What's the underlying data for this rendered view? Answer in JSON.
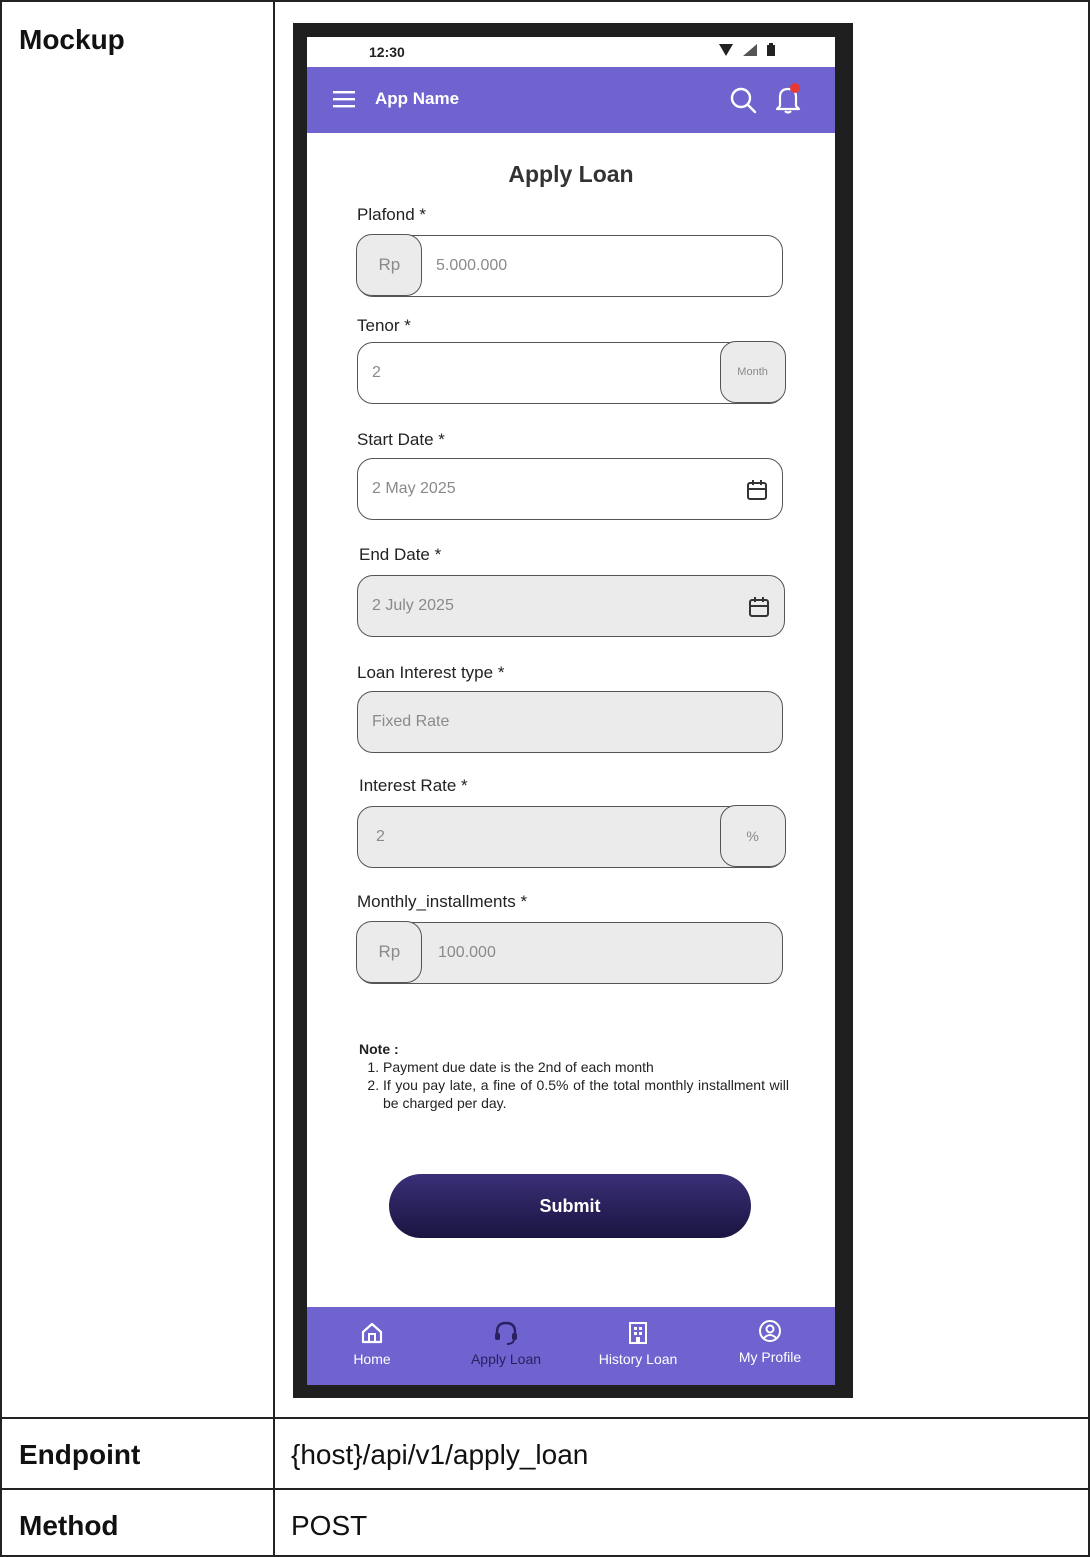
{
  "table": {
    "mockup_label": "Mockup",
    "endpoint_label": "Endpoint",
    "endpoint_value": "{host}/api/v1/apply_loan",
    "method_label": "Method",
    "method_value": "POST"
  },
  "status_bar": {
    "time": "12:30"
  },
  "app_bar": {
    "title": "App Name"
  },
  "form": {
    "title": "Apply Loan",
    "plafond": {
      "label": "Plafond *",
      "prefix": "Rp",
      "value": "5.000.000"
    },
    "tenor": {
      "label": "Tenor *",
      "value": "2",
      "suffix": "Month"
    },
    "start_date": {
      "label": "Start Date *",
      "value": "2 May 2025"
    },
    "end_date": {
      "label": "End Date *",
      "value": "2 July 2025"
    },
    "interest_type": {
      "label": "Loan Interest type *",
      "value": "Fixed Rate"
    },
    "interest_rate": {
      "label": "Interest Rate *",
      "value": "2",
      "suffix": "%"
    },
    "monthly_installments": {
      "label": "Monthly_installments *",
      "prefix": "Rp",
      "value": "100.000"
    }
  },
  "note": {
    "title": "Note :",
    "items": [
      "Payment due date is the 2nd of each month",
      "If you pay late, a fine of 0.5% of the total monthly installment will be charged per day."
    ]
  },
  "submit_label": "Submit",
  "bottom_nav": {
    "items": [
      {
        "label": "Home",
        "icon": "home-icon"
      },
      {
        "label": "Apply Loan",
        "icon": "headset-icon"
      },
      {
        "label": "History Loan",
        "icon": "building-icon"
      },
      {
        "label": "My Profile",
        "icon": "profile-icon"
      }
    ]
  },
  "colors": {
    "primary": "#6e63cf",
    "button": "#1f1a4d",
    "notification": "#e53935"
  }
}
